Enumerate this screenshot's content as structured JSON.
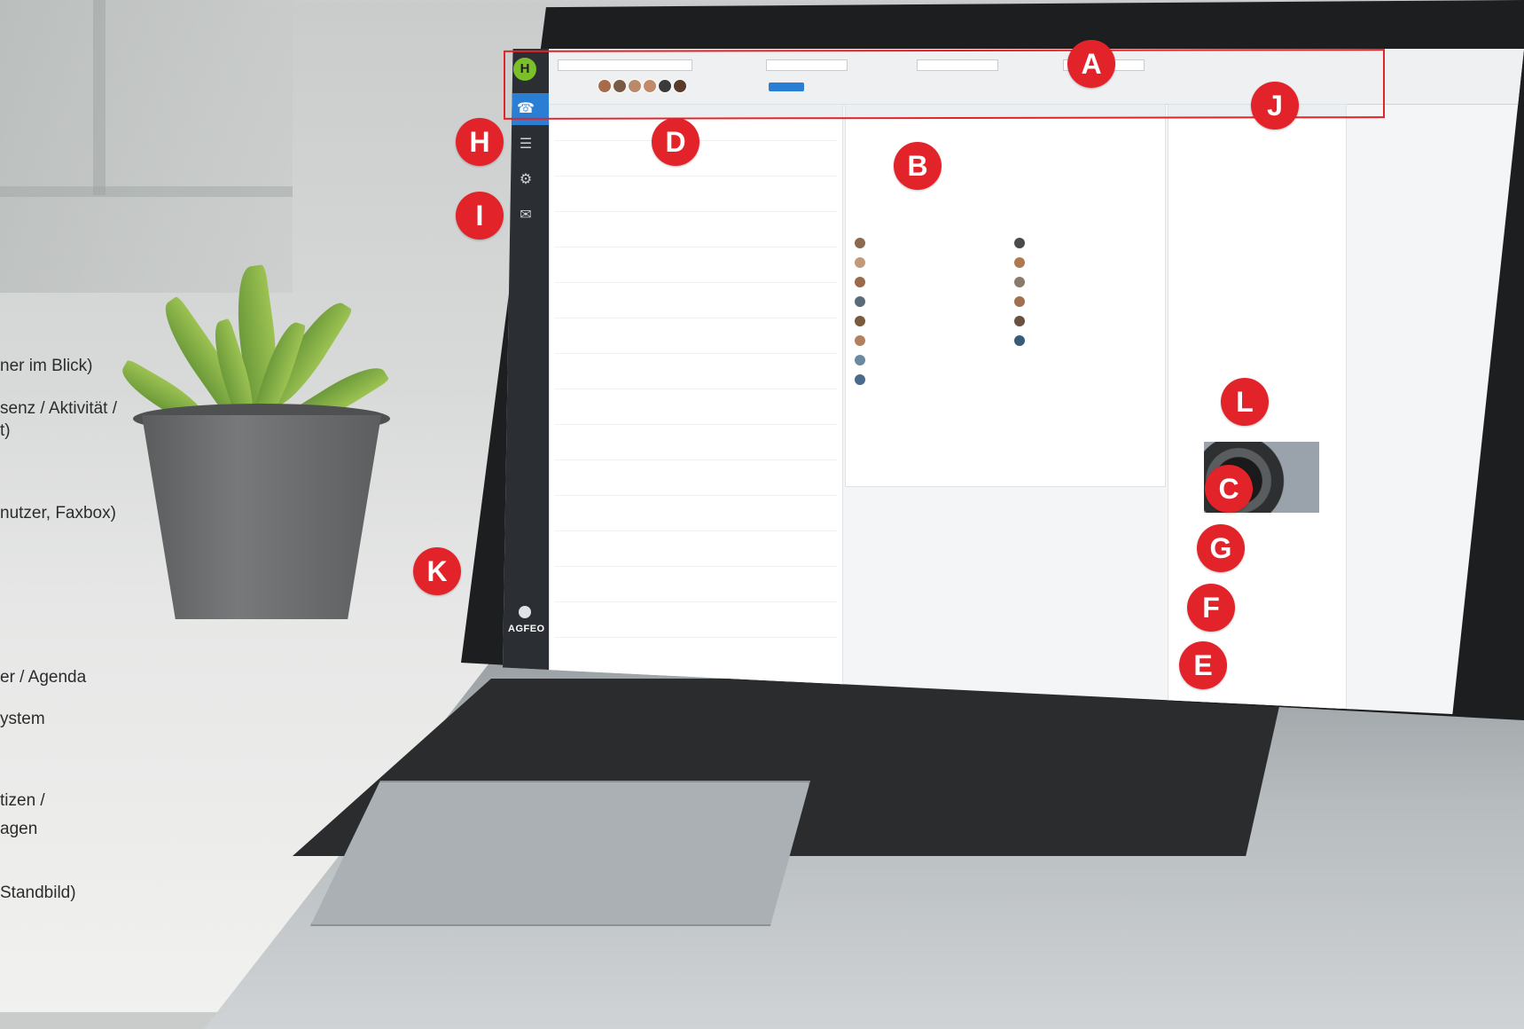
{
  "captions": [
    "ner im Blick)",
    "senz / Aktivität /",
    "t)",
    "nutzer, Faxbox)",
    "er / Agenda",
    "ystem",
    "tizen /",
    "agen",
    "Standbild)"
  ],
  "markers": [
    "A",
    "B",
    "C",
    "D",
    "E",
    "F",
    "G",
    "H",
    "I",
    "J",
    "K",
    "L"
  ],
  "brand": "AGFEO",
  "colors": {
    "marker": "#e3232a",
    "sidebar": "#2b2e33",
    "accent": "#2a7fd4",
    "logo": "#7bbf2a"
  },
  "icons": [
    "plant-image",
    "laptop-image",
    "phone-icon",
    "contacts-icon",
    "chat-icon",
    "settings-icon"
  ]
}
